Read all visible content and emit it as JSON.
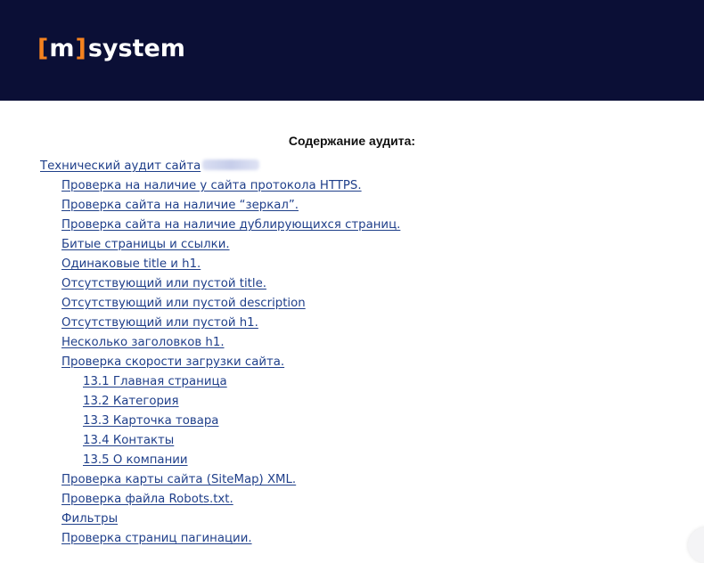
{
  "header": {
    "logo": {
      "bracket_open": "[",
      "letter": "m",
      "bracket_close": "]",
      "rest": "system"
    },
    "brand_color": "#0b0f36",
    "accent_color": "#f5821f"
  },
  "toc": {
    "title": "Содержание аудита:",
    "items": [
      {
        "label": "Технический аудит сайта",
        "level": 0,
        "has_redacted": true
      },
      {
        "label": "Проверка на наличие у сайта протокола HTTPS.",
        "level": 1
      },
      {
        "label": "Проверка сайта на наличие “зеркал”.",
        "level": 1
      },
      {
        "label": "Проверка сайта на наличие дублирующихся страниц.",
        "level": 1
      },
      {
        "label": "Битые страницы и ссылки.",
        "level": 1
      },
      {
        "label": "Одинаковые title и h1.",
        "level": 1
      },
      {
        "label": "Отсутствующий или пустой title.",
        "level": 1
      },
      {
        "label": "Отсутствующий или пустой description",
        "level": 1
      },
      {
        "label": "Отсутствующий или пустой h1.",
        "level": 1
      },
      {
        "label": "Несколько заголовков h1.",
        "level": 1
      },
      {
        "label": "Проверка скорости загрузки сайта.",
        "level": 1
      },
      {
        "label": "13.1 Главная страница",
        "level": 2
      },
      {
        "label": "13.2  Категория",
        "level": 2
      },
      {
        "label": "13.3  Карточка товара",
        "level": 2
      },
      {
        "label": "13.4  Контакты",
        "level": 2
      },
      {
        "label": "13.5  О компании",
        "level": 2
      },
      {
        "label": "Проверка карты сайта (SiteMap) XML.",
        "level": 1
      },
      {
        "label": "Проверка файла Robots.txt.",
        "level": 1
      },
      {
        "label": "Фильтры",
        "level": 1
      },
      {
        "label": "Проверка страниц пагинации.",
        "level": 1
      }
    ]
  }
}
